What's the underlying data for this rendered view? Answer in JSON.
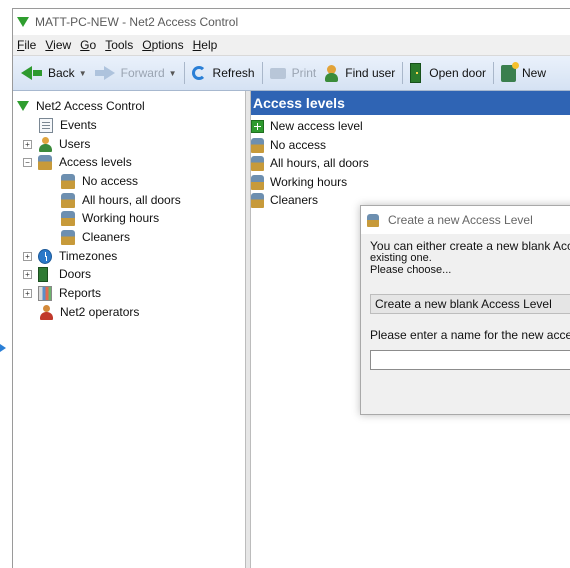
{
  "window": {
    "title": "MATT-PC-NEW - Net2 Access Control"
  },
  "menu": [
    {
      "key": "F",
      "rest": "ile"
    },
    {
      "key": "V",
      "rest": "iew"
    },
    {
      "key": "G",
      "rest": "o"
    },
    {
      "key": "T",
      "rest": "ools"
    },
    {
      "key": "O",
      "rest": "ptions"
    },
    {
      "key": "H",
      "rest": "elp"
    }
  ],
  "toolbar": {
    "back": "Back",
    "forward": "Forward",
    "refresh": "Refresh",
    "print": "Print",
    "find_user": "Find user",
    "open_door": "Open door",
    "new": "New"
  },
  "tree": {
    "root": "Net2 Access Control",
    "events": "Events",
    "users": "Users",
    "access_levels": "Access levels",
    "al_children": [
      "No access",
      "All hours, all doors",
      "Working hours",
      "Cleaners"
    ],
    "timezones": "Timezones",
    "doors": "Doors",
    "reports": "Reports",
    "operators": "Net2 operators",
    "expand_plus": "+",
    "expand_minus": "−"
  },
  "panel": {
    "header": "Access levels",
    "items": [
      "New access level",
      "No access",
      "All hours, all doors",
      "Working hours",
      "Cleaners"
    ]
  },
  "dialog": {
    "title": "Create a new Access Level",
    "intro_line1": "You can either create a new blank Acc",
    "intro_line2": "existing one.",
    "intro_line3": "Please choose...",
    "selected_option": "Create a new blank Access Level",
    "name_label": "Please enter a name for the new acce",
    "name_value": ""
  }
}
